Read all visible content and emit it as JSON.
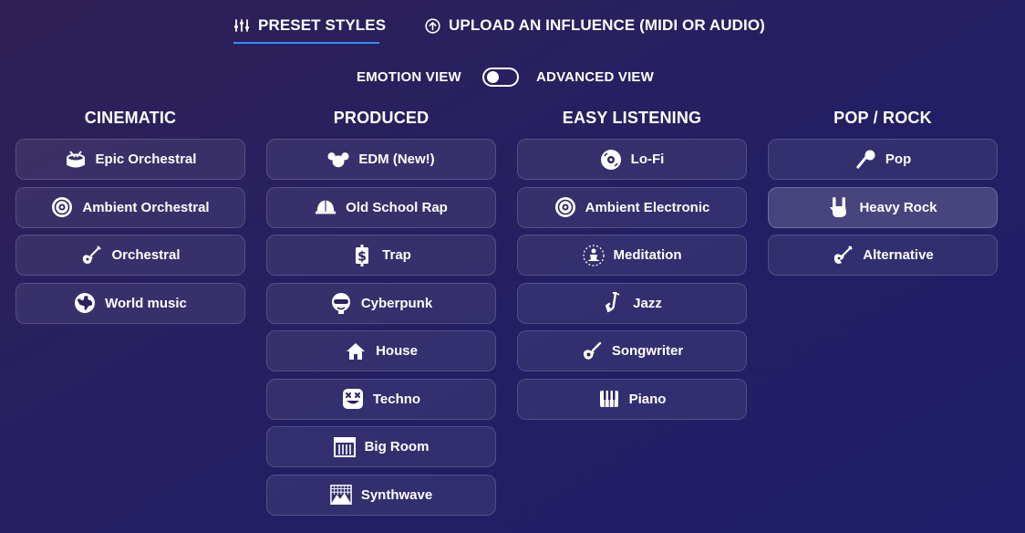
{
  "tabs": {
    "preset_label": "PRESET STYLES",
    "upload_label": "UPLOAD AN INFLUENCE (MIDI OR AUDIO)",
    "active": "preset",
    "accent_color": "#2f8cff"
  },
  "view_toggle": {
    "left_label": "EMOTION VIEW",
    "right_label": "ADVANCED VIEW",
    "state": "off"
  },
  "columns": [
    {
      "title": "CINEMATIC",
      "items": [
        {
          "label": "Epic Orchestral",
          "icon": "drum-icon"
        },
        {
          "label": "Ambient Orchestral",
          "icon": "vinyl-circle-icon"
        },
        {
          "label": "Orchestral",
          "icon": "violin-icon"
        },
        {
          "label": "World music",
          "icon": "globe-icon"
        }
      ]
    },
    {
      "title": "PRODUCED",
      "items": [
        {
          "label": "EDM (New!)",
          "icon": "mouse-ears-icon"
        },
        {
          "label": "Old School Rap",
          "icon": "cap-icon"
        },
        {
          "label": "Trap",
          "icon": "dollar-icon"
        },
        {
          "label": "Cyberpunk",
          "icon": "visor-head-icon"
        },
        {
          "label": "House",
          "icon": "house-icon"
        },
        {
          "label": "Techno",
          "icon": "x-face-icon"
        },
        {
          "label": "Big Room",
          "icon": "speaker-grid-icon"
        },
        {
          "label": "Synthwave",
          "icon": "grid-sunset-icon"
        }
      ]
    },
    {
      "title": "EASY LISTENING",
      "items": [
        {
          "label": "Lo-Fi",
          "icon": "record-icon"
        },
        {
          "label": "Ambient Electronic",
          "icon": "vinyl-circle-icon"
        },
        {
          "label": "Meditation",
          "icon": "meditation-icon"
        },
        {
          "label": "Jazz",
          "icon": "saxophone-icon"
        },
        {
          "label": "Songwriter",
          "icon": "acoustic-guitar-icon"
        },
        {
          "label": "Piano",
          "icon": "piano-keys-icon"
        }
      ]
    },
    {
      "title": "POP / ROCK",
      "items": [
        {
          "label": "Pop",
          "icon": "microphone-icon"
        },
        {
          "label": "Heavy Rock",
          "icon": "rock-hand-icon",
          "selected": true
        },
        {
          "label": "Alternative",
          "icon": "electric-guitar-icon"
        }
      ]
    }
  ]
}
